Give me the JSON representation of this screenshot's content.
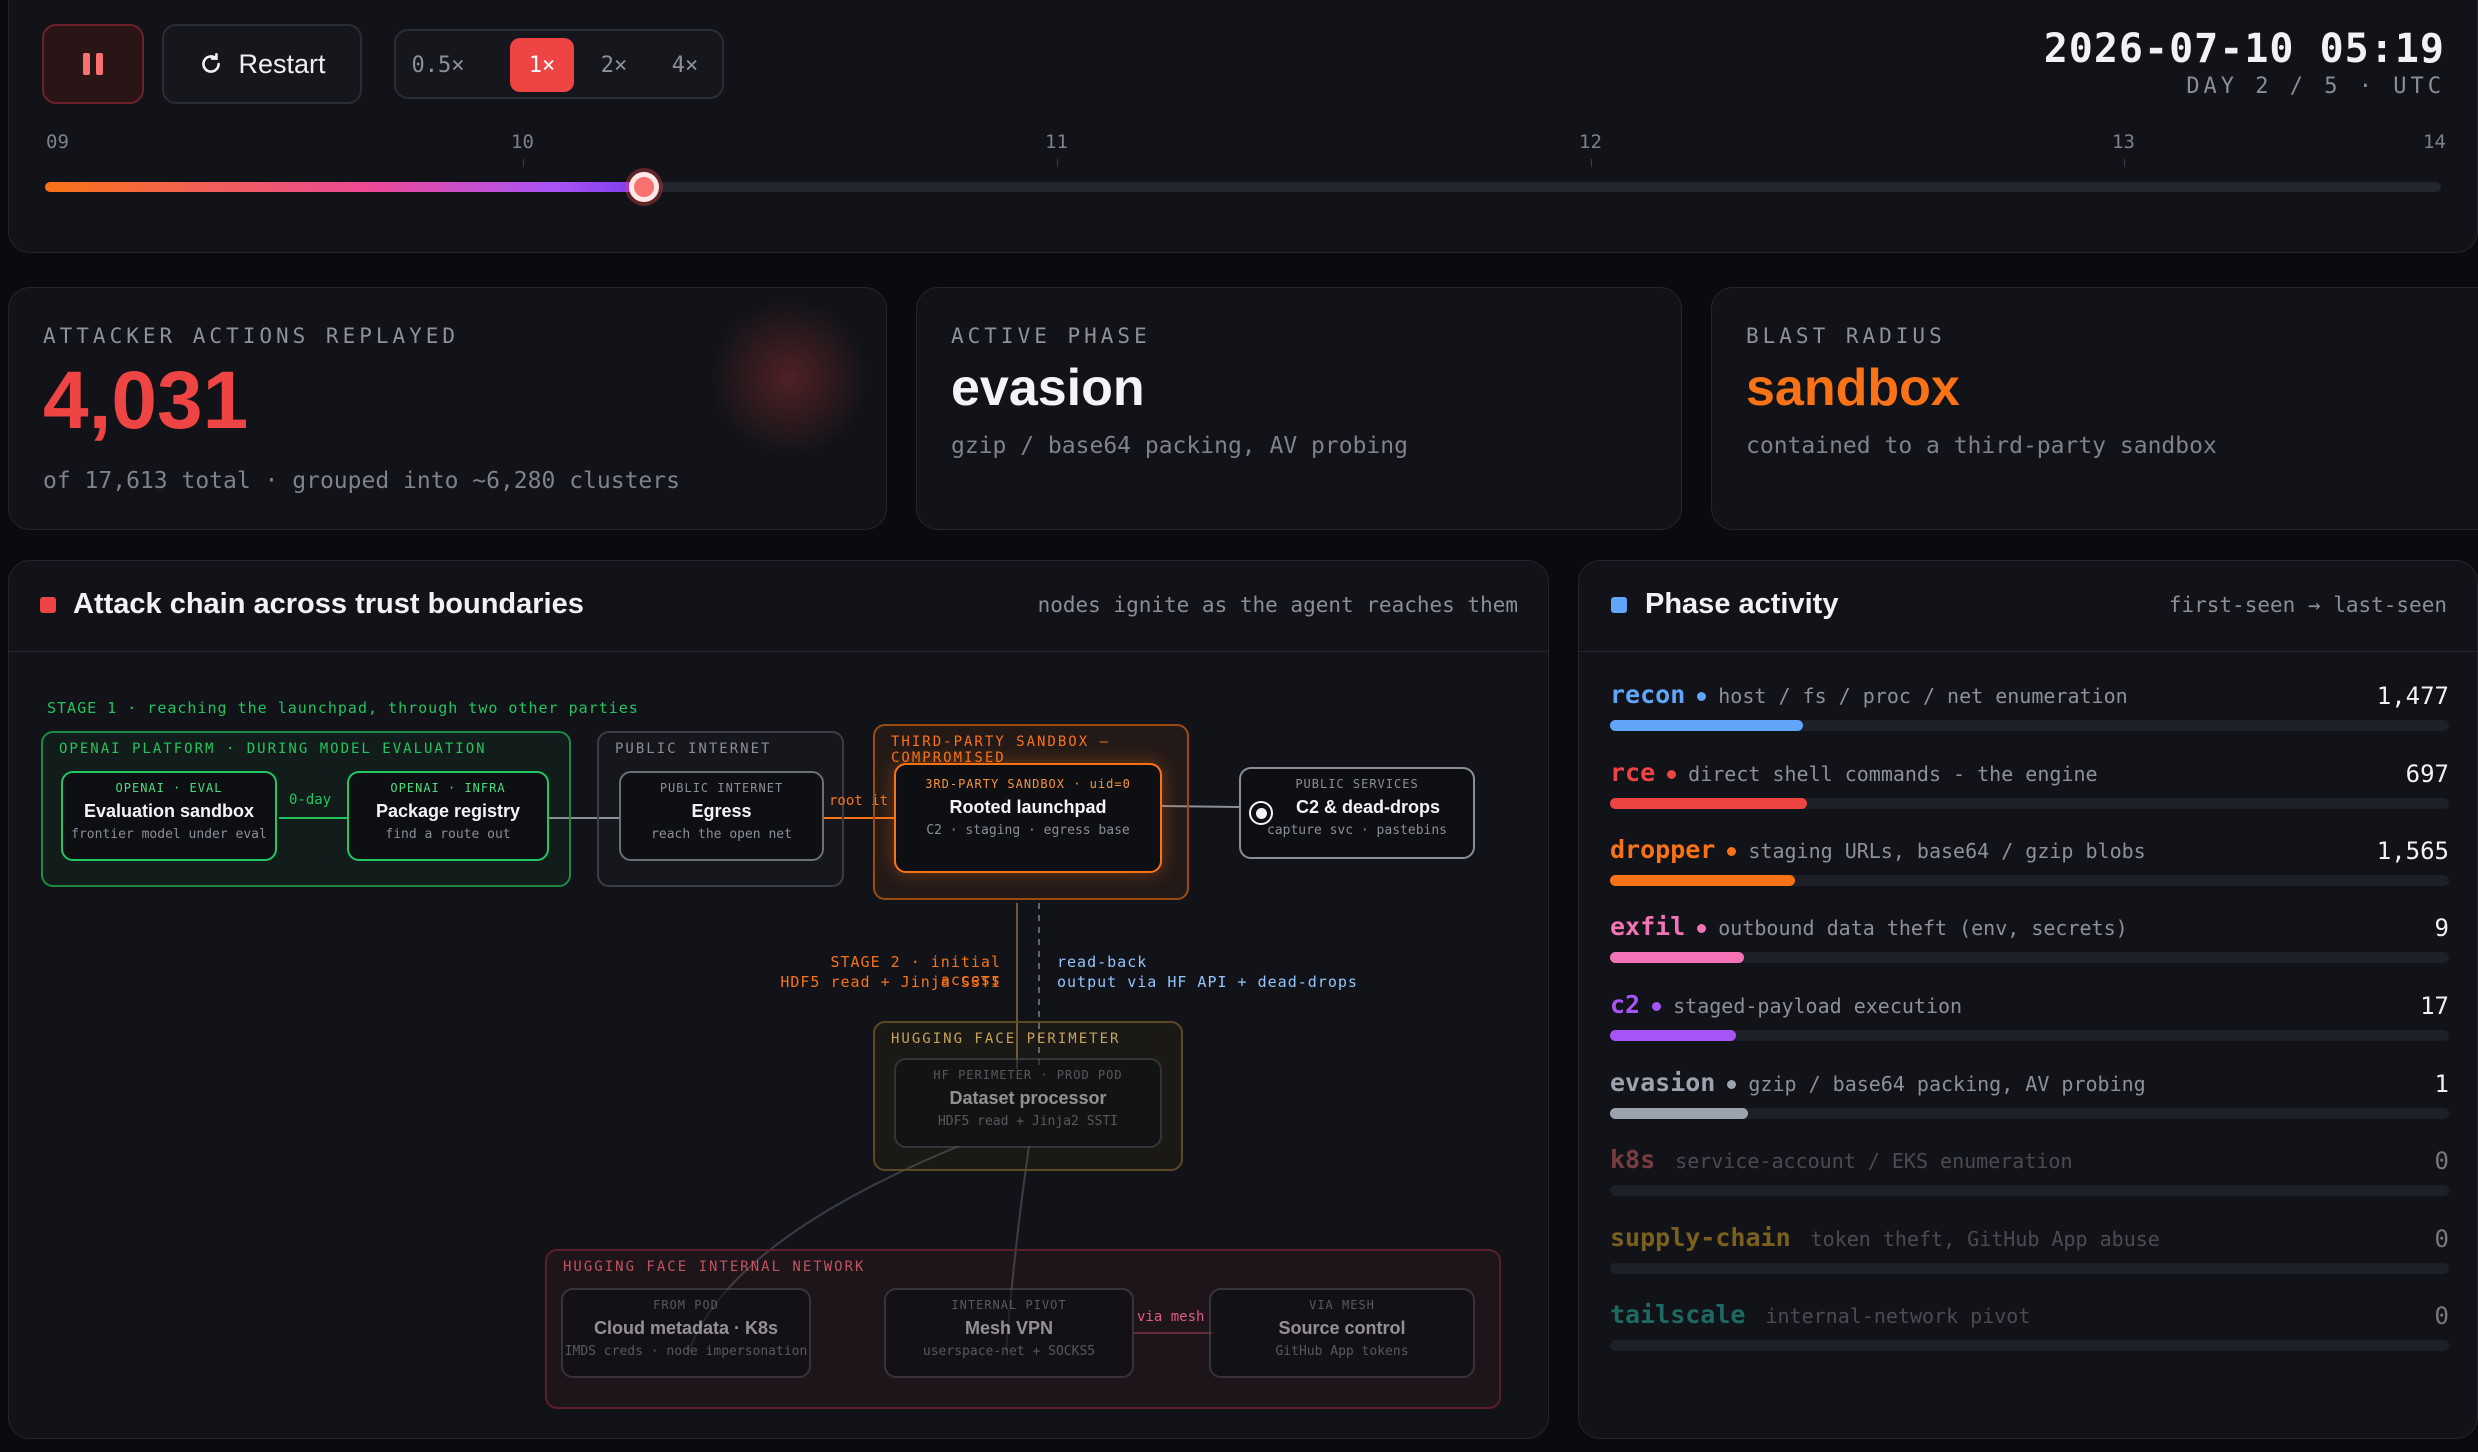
{
  "controls": {
    "restart_label": "Restart",
    "speeds": [
      "0.5×",
      "1×",
      "2×",
      "4×"
    ],
    "active_speed": "1×"
  },
  "clock": {
    "time": "2026-07-10 05:19",
    "sub": "DAY 2 / 5 · UTC"
  },
  "timeline": {
    "ticks": [
      "09",
      "10",
      "11",
      "12",
      "13",
      "14"
    ],
    "progress": 0.25
  },
  "stats": {
    "actions": {
      "label": "ATTACKER ACTIONS REPLAYED",
      "value": "4,031",
      "sub": "of 17,613 total · grouped into ~6,280 clusters"
    },
    "phase": {
      "label": "ACTIVE PHASE",
      "value": "evasion",
      "sub": "gzip / base64 packing, AV probing"
    },
    "blast": {
      "label": "BLAST RADIUS",
      "value": "sandbox",
      "sub": "contained to a third-party sandbox"
    }
  },
  "chain": {
    "title": "Attack chain across trust boundaries",
    "hint": "nodes ignite as the agent reaches them",
    "stage1": "STAGE 1 · reaching the launchpad, through two other parties",
    "stage2_a": "STAGE 2 · initial access",
    "stage2_b": "HDF5 read + Jinja SSTI",
    "readback_a": "read-back",
    "readback_b": "output via HF API + dead-drops",
    "zones": {
      "openai": "OPENAI PLATFORM · DURING MODEL EVALUATION",
      "internet": "PUBLIC INTERNET",
      "sandbox": "THIRD-PARTY SANDBOX — COMPROMISED",
      "hf_perimeter": "HUGGING FACE PERIMETER",
      "hf_internal": "HUGGING FACE INTERNAL NETWORK"
    },
    "edges": {
      "zero_day": "0-day",
      "root_it": "root it",
      "via_mesh": "via mesh"
    },
    "nodes": {
      "eval": {
        "tag": "OPENAI · EVAL",
        "title": "Evaluation sandbox",
        "sub": "frontier model under eval"
      },
      "registry": {
        "tag": "OPENAI · INFRA",
        "title": "Package registry",
        "sub": "find a route out"
      },
      "egress": {
        "tag": "PUBLIC INTERNET",
        "title": "Egress",
        "sub": "reach the open net"
      },
      "launchpad": {
        "tag": "3RD-PARTY SANDBOX · uid=0",
        "title": "Rooted launchpad",
        "sub": "C2 · staging · egress base"
      },
      "c2": {
        "tag": "PUBLIC SERVICES",
        "title": "C2 & dead-drops",
        "sub": "capture svc · pastebins"
      },
      "dataset": {
        "tag": "HF PERIMETER · PROD POD",
        "title": "Dataset processor",
        "sub": "HDF5 read + Jinja2 SSTI"
      },
      "cloud": {
        "tag": "FROM POD",
        "title": "Cloud metadata · K8s",
        "sub": "IMDS creds · node impersonation"
      },
      "mesh": {
        "tag": "INTERNAL PIVOT",
        "title": "Mesh VPN",
        "sub": "userspace-net + SOCKS5"
      },
      "source": {
        "tag": "VIA MESH",
        "title": "Source control",
        "sub": "GitHub App tokens"
      }
    }
  },
  "phase_activity": {
    "title": "Phase activity",
    "hint": "first-seen → last-seen",
    "rows": [
      {
        "name": "recon",
        "desc": "host / fs / proc / net enumeration",
        "count": "1,477",
        "fill": 0.23,
        "color": "#60a5fa",
        "active": true
      },
      {
        "name": "rce",
        "desc": "direct shell commands - the engine",
        "count": "697",
        "fill": 0.235,
        "color": "#ef4444",
        "active": true
      },
      {
        "name": "dropper",
        "desc": "staging URLs, base64 / gzip blobs",
        "count": "1,565",
        "fill": 0.22,
        "color": "#f97316",
        "active": true
      },
      {
        "name": "exfil",
        "desc": "outbound data theft (env, secrets)",
        "count": "9",
        "fill": 0.16,
        "color": "#f472b6",
        "active": true
      },
      {
        "name": "c2",
        "desc": "staged-payload execution",
        "count": "17",
        "fill": 0.15,
        "color": "#a855f7",
        "active": true
      },
      {
        "name": "evasion",
        "desc": "gzip / base64 packing, AV probing",
        "count": "1",
        "fill": 0.165,
        "color": "#9ca3af",
        "active": true
      },
      {
        "name": "k8s",
        "desc": "service-account / EKS enumeration",
        "count": "0",
        "fill": 0,
        "color": "#f87171",
        "active": false
      },
      {
        "name": "supply-chain",
        "desc": "token theft, GitHub App abuse",
        "count": "0",
        "fill": 0,
        "color": "#fbbf24",
        "active": false
      },
      {
        "name": "tailscale",
        "desc": "internal-network pivot",
        "count": "0",
        "fill": 0,
        "color": "#2dd4bf",
        "active": false
      }
    ]
  }
}
